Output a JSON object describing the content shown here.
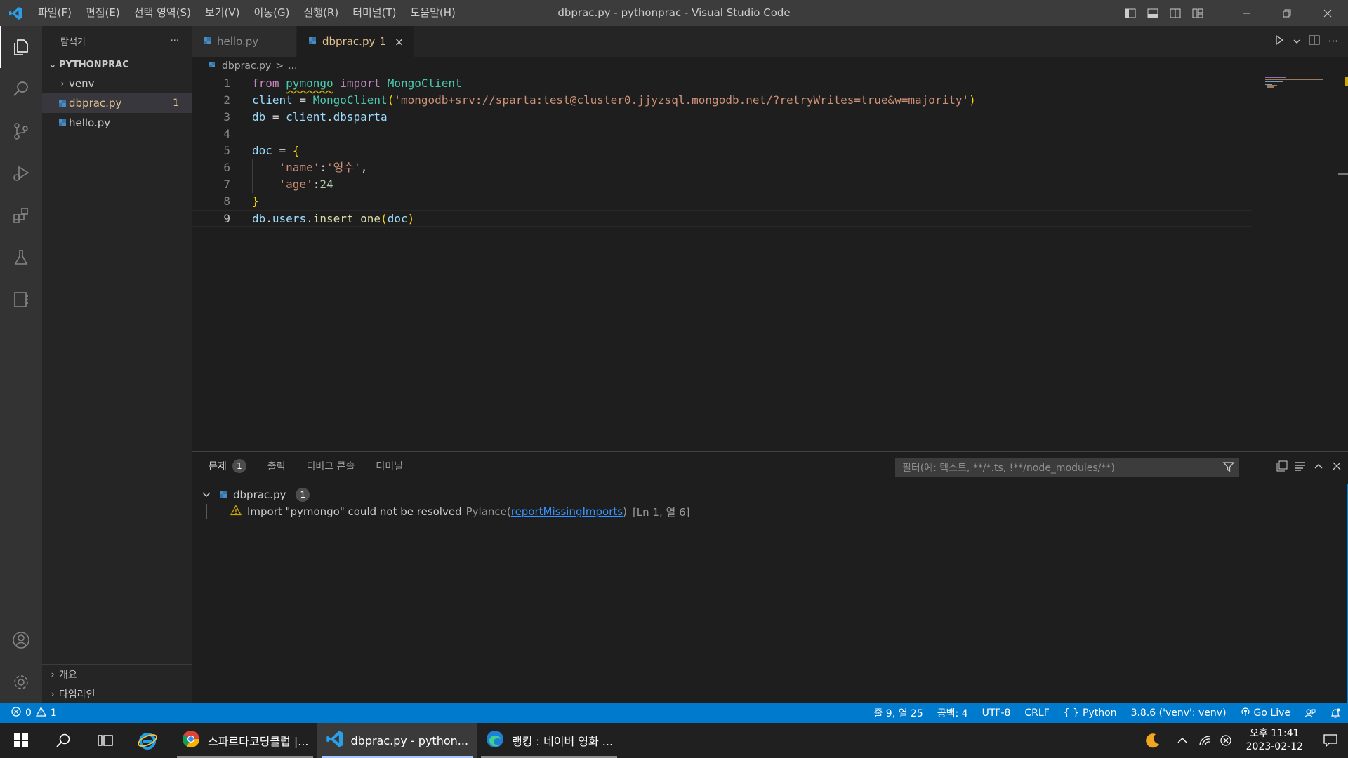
{
  "window": {
    "title": "dbprac.py - pythonprac - Visual Studio Code"
  },
  "menu": [
    "파일(F)",
    "편집(E)",
    "선택 영역(S)",
    "보기(V)",
    "이동(G)",
    "실행(R)",
    "터미널(T)",
    "도움말(H)"
  ],
  "sidebar": {
    "title": "탐색기",
    "more": "···",
    "section": "PYTHONPRAC",
    "items": [
      {
        "label": "venv",
        "type": "folder"
      },
      {
        "label": "dbprac.py",
        "type": "file",
        "badge": "1",
        "selected": true
      },
      {
        "label": "hello.py",
        "type": "file"
      }
    ],
    "bottom": [
      "개요",
      "타임라인"
    ]
  },
  "tabs": [
    {
      "label": "hello.py",
      "active": false
    },
    {
      "label": "dbprac.py",
      "badge": "1",
      "active": true,
      "close": "×"
    }
  ],
  "breadcrumb": {
    "file": "dbprac.py",
    "sep": ">",
    "rest": "..."
  },
  "editor": {
    "line_numbers": [
      "1",
      "2",
      "3",
      "4",
      "5",
      "6",
      "7",
      "8",
      "9"
    ],
    "current_line": 9,
    "code": {
      "l1_from": "from",
      "l1_mod": "pymongo",
      "l1_import": "import",
      "l1_cls": "MongoClient",
      "l2_var": "client",
      "l2_eq": " = ",
      "l2_cls": "MongoClient",
      "l2_open": "(",
      "l2_str": "'mongodb+srv://sparta:test@cluster0.jjyzsql.mongodb.net/?retryWrites=true&w=majority'",
      "l2_close": ")",
      "l3_var": "db",
      "l3_eq": " = ",
      "l3_obj": "client",
      "l3_dot": ".",
      "l3_attr": "dbsparta",
      "l5_var": "doc",
      "l5_eq": " = ",
      "l5_brace": "{",
      "l6_key": "'name'",
      "l6_colon": ":",
      "l6_val": "'영수'",
      "l6_comma": ",",
      "l7_key": "'age'",
      "l7_colon": ":",
      "l7_val": "24",
      "l8_brace": "}",
      "l9_obj": "db",
      "l9_dot1": ".",
      "l9_attr": "users",
      "l9_dot2": ".",
      "l9_fn": "insert_one",
      "l9_open": "(",
      "l9_arg": "doc",
      "l9_close": ")"
    }
  },
  "panel": {
    "tabs": [
      {
        "label": "문제",
        "badge": "1",
        "active": true
      },
      {
        "label": "출력"
      },
      {
        "label": "디버그 콘솔"
      },
      {
        "label": "터미널"
      }
    ],
    "filter_placeholder": "필터(예: 텍스트, **/*.ts, !**/node_modules/**)",
    "problem_file": {
      "label": "dbprac.py",
      "count": "1"
    },
    "problem": {
      "message": "Import \"pymongo\" could not be resolved",
      "source": "Pylance",
      "code_open": "(",
      "code": "reportMissingImports",
      "code_close": ")",
      "location": "[Ln 1, 열 6]"
    }
  },
  "statusbar": {
    "errors": "0",
    "warnings": "1",
    "position": "줄 9, 열 25",
    "spaces": "공백: 4",
    "encoding": "UTF-8",
    "eol": "CRLF",
    "language": "Python",
    "interpreter": "3.8.6 ('venv': venv)",
    "golive": "Go Live"
  },
  "taskbar": {
    "apps": [
      {
        "label": "스파르타코딩클럽 |...",
        "icon": "chrome-icon"
      },
      {
        "label": "dbprac.py - python...",
        "icon": "vscode-icon",
        "active": true
      },
      {
        "label": "랭킹 : 네이버 영화 ...",
        "icon": "edge-icon"
      }
    ],
    "time": "오후 11:41",
    "date": "2023-02-12"
  },
  "colors": {
    "statusbar": "#007acc",
    "accent_modified": "#e2c08d",
    "link": "#3794ff"
  }
}
